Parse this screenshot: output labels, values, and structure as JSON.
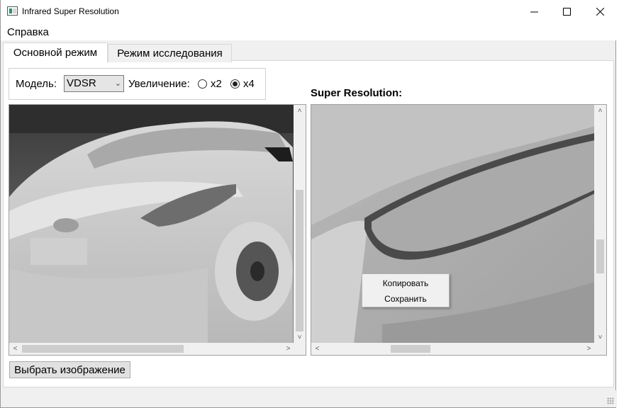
{
  "window": {
    "title": "Infrared Super Resolution",
    "minimize_icon": "minimize-icon",
    "maximize_icon": "maximize-icon",
    "close_icon": "close-icon"
  },
  "menubar": {
    "items": [
      "Справка"
    ]
  },
  "tabs": [
    {
      "label": "Основной режим",
      "active": true
    },
    {
      "label": "Режим исследования",
      "active": false
    }
  ],
  "controls": {
    "model_label": "Модель:",
    "model_value": "VDSR",
    "zoom_label": "Увеличение:",
    "zoom_options": [
      {
        "label": "x2",
        "checked": false
      },
      {
        "label": "x4",
        "checked": true
      }
    ]
  },
  "super_resolution_label": "Super Resolution:",
  "context_menu": {
    "items": [
      "Копировать",
      "Сохранить"
    ]
  },
  "select_image_button": "Выбрать изображение",
  "colors": {
    "window_bg": "#f0f0f0",
    "panel_bg": "#ffffff"
  }
}
